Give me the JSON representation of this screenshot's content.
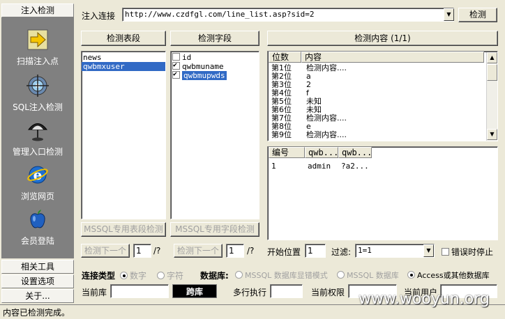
{
  "sidebar": {
    "tab_top": "注入检测",
    "nav": [
      {
        "label": "扫描注入点",
        "icon": "arrow-right-icon"
      },
      {
        "label": "SQL注入检测",
        "icon": "target-icon"
      },
      {
        "label": "管理入口检测",
        "icon": "umbrella-icon"
      },
      {
        "label": "浏览网页",
        "icon": "ie-browser-icon"
      },
      {
        "label": "会员登陆",
        "icon": "apple-icon"
      }
    ],
    "tabs_bottom": [
      "相关工具",
      "设置选项",
      "关于..."
    ]
  },
  "url_bar": {
    "label": "注入连接",
    "value": "http://www.czdfgl.com/line_list.asp?sid=2",
    "check_button": "检测"
  },
  "panels": {
    "tables_button": "检测表段",
    "fields_button": "检测字段",
    "content_button": "检测内容 (1/1)"
  },
  "tables": [
    "news",
    "qwbmxuser"
  ],
  "tables_selected": 1,
  "fields": [
    {
      "name": "id",
      "checked": false
    },
    {
      "name": "qwbmuname",
      "checked": true
    },
    {
      "name": "qwbmupwds",
      "checked": true
    }
  ],
  "fields_selected": 2,
  "content_grid": {
    "headers": [
      "位数",
      "内容"
    ],
    "rows": [
      [
        "第1位",
        "检测内容...."
      ],
      [
        "第2位",
        "a"
      ],
      [
        "第3位",
        "2"
      ],
      [
        "第4位",
        "f"
      ],
      [
        "第5位",
        "未知"
      ],
      [
        "第6位",
        "未知"
      ],
      [
        "第7位",
        "检测内容...."
      ],
      [
        "第8位",
        "e"
      ],
      [
        "第9位",
        "检测内容...."
      ]
    ]
  },
  "result_grid": {
    "headers": [
      "编号",
      "qwb...",
      "qwb..."
    ],
    "rows": [
      [
        "1",
        "admin",
        "?a2..."
      ]
    ]
  },
  "mssql_buttons": {
    "table": "MSSQL专用表段检测",
    "field": "MSSQL专用字段检测"
  },
  "next_row": {
    "next_table": "检测下一个",
    "table_page": "1",
    "table_total": "/?",
    "next_field": "检测下一个",
    "field_page": "1",
    "field_total": "/?",
    "start_label": "开始位置",
    "start_value": "1",
    "filter_label": "过滤:",
    "filter_value": "1=1",
    "stop_on_error": "错误时停止"
  },
  "connection": {
    "type_label": "连接类型",
    "type_numeric": "数字",
    "type_char": "字符",
    "db_label": "数据库:",
    "db_mssql_error": "MSSQL 数据库显错模式",
    "db_mssql": "MSSQL 数据库",
    "db_access": "Access或其他数据库"
  },
  "bottom_row": {
    "current_db": "当前库",
    "cross_db": "跨库",
    "multi_exec": "多行执行",
    "current_priv": "当前权限",
    "current_user": "当前用户"
  },
  "status": "内容已检测完成。",
  "watermark": "www.wooyun.org"
}
